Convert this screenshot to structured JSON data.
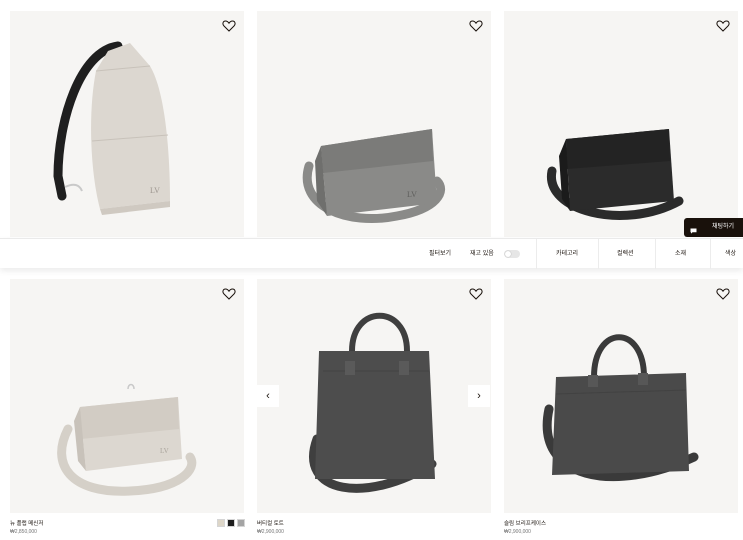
{
  "filter_bar": {
    "filter_label": "필터보기",
    "stock_label": "재고 있음",
    "stock_toggle_on": false,
    "category_label": "카테고리",
    "collection_label": "컬렉션",
    "material_label": "소재",
    "color_label": "색상"
  },
  "chat": {
    "label": "채팅하기"
  },
  "carousel": {
    "prev_glyph": "‹",
    "next_glyph": "›"
  },
  "products": [
    {
      "id": "sling",
      "name": "",
      "price": ""
    },
    {
      "id": "messenger-grey",
      "name": "",
      "price": ""
    },
    {
      "id": "messenger-black",
      "name": "",
      "price": ""
    },
    {
      "id": "new-flap-messenger",
      "name": "뉴 플랩 메신저",
      "price": "₩2,850,000",
      "swatches": [
        {
          "name": "beige",
          "color": "#ddd6c8"
        },
        {
          "name": "black",
          "color": "#1d1d1d"
        },
        {
          "name": "grey",
          "color": "#a4a4a4"
        }
      ]
    },
    {
      "id": "vertical-tote",
      "name": "버티컬 토트",
      "price": "₩2,900,000"
    },
    {
      "id": "slim-briefcase",
      "name": "슬림 브리프케이스",
      "price": "₩2,900,000"
    }
  ],
  "colors": {
    "card_bg": "#f6f5f3",
    "accent_dark": "#19110b",
    "leather_cream": "#dcd7d0",
    "leather_grey": "#8a8a88",
    "leather_black": "#2b2b2b",
    "leather_charcoal": "#4d4d4d"
  },
  "icons": [
    "heart-icon",
    "chat-bubble-icon",
    "chevron-left-icon",
    "chevron-right-icon"
  ]
}
